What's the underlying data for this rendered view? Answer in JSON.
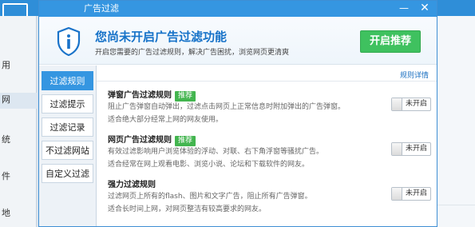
{
  "background_app": {
    "sidebar_items": [
      "用",
      "网",
      "统",
      "件",
      "地"
    ]
  },
  "dialog": {
    "title": "广告过滤",
    "window_controls": {
      "minimize": "—",
      "close": "✕"
    },
    "banner": {
      "title": "您尚未开启广告过滤功能",
      "subtitle": "开启您需要的广告过滤规则，解决广告困扰，浏览网页更清爽",
      "enable_button": "开启推荐"
    },
    "tabs": [
      {
        "label": "过滤规则",
        "active": true
      },
      {
        "label": "过滤提示",
        "active": false
      },
      {
        "label": "过滤记录",
        "active": false
      },
      {
        "label": "不过滤网站",
        "active": false
      },
      {
        "label": "自定义过滤",
        "active": false
      }
    ],
    "rules_detail_link": "规则详情",
    "rules": [
      {
        "title": "弹窗广告过滤规则",
        "tag": "推荐",
        "description": "阻止广告弹窗自动弹出，过滤点击网页上正常信息时附加弹出的广告弹窗。",
        "note": "适合绝大部分经常上网的网友使用。",
        "toggle_label": "未开启"
      },
      {
        "title": "网页广告过滤规则",
        "tag": "推荐",
        "description": "有效过滤影响用户浏览体验的浮动、对联、右下角浮窗等骚扰广告。",
        "note": "适合经常在网上观看电影、浏览小说、论坛和下载软件的网友。",
        "toggle_label": "未开启"
      },
      {
        "title": "强力过滤规则",
        "tag": "",
        "description": "过滤网页上所有的flash、图片和文字广告，阻止所有广告弹窗。",
        "note": "适合长时间上网，对网页整洁有较高要求的网友。",
        "toggle_label": "未开启"
      }
    ]
  },
  "colors": {
    "accent_blue": "#3596e1",
    "title_blue": "#1672c8",
    "enable_green": "#3fc15f",
    "tag_green": "#43b54f"
  }
}
